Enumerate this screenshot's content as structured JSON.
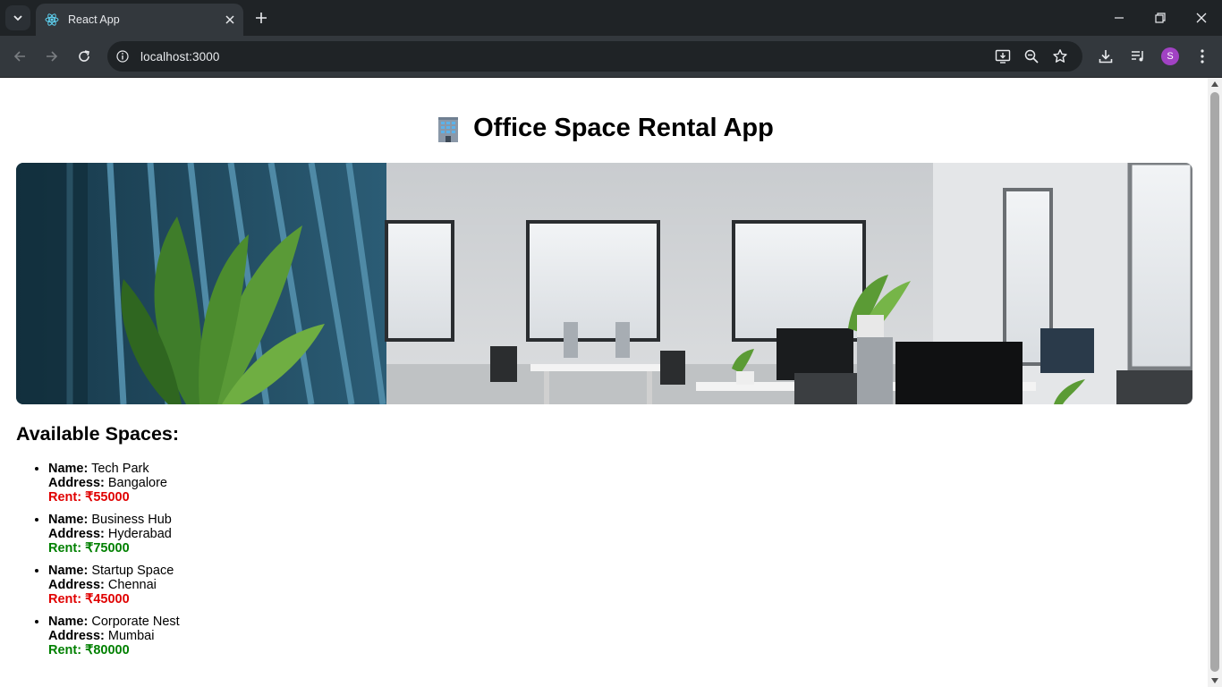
{
  "browser": {
    "tab_title": "React App",
    "url": "localhost:3000",
    "profile_initial": "S",
    "icons": [
      "tab-search-icon",
      "react-favicon-icon",
      "tab-close-icon",
      "new-tab-icon",
      "minimize-icon",
      "restore-icon",
      "close-window-icon",
      "back-icon",
      "forward-icon",
      "reload-icon",
      "site-info-icon",
      "install-app-icon",
      "zoom-icon",
      "bookmark-star-icon",
      "downloads-icon",
      "media-control-icon",
      "menu-icon"
    ]
  },
  "page": {
    "title": "Office Space Rental App",
    "title_emoji": "office-building-icon",
    "banner_alt": "office interior",
    "section_title": "Available Spaces:",
    "labels": {
      "name": "Name:",
      "address": "Address:",
      "rent": "Rent: ₹"
    },
    "spaces": [
      {
        "name": "Tech Park",
        "address": "Bangalore",
        "rent": "55000",
        "rent_color": "#e00000"
      },
      {
        "name": "Business Hub",
        "address": "Hyderabad",
        "rent": "75000",
        "rent_color": "#008000"
      },
      {
        "name": "Startup Space",
        "address": "Chennai",
        "rent": "45000",
        "rent_color": "#e00000"
      },
      {
        "name": "Corporate Nest",
        "address": "Mumbai",
        "rent": "80000",
        "rent_color": "#008000"
      }
    ]
  }
}
